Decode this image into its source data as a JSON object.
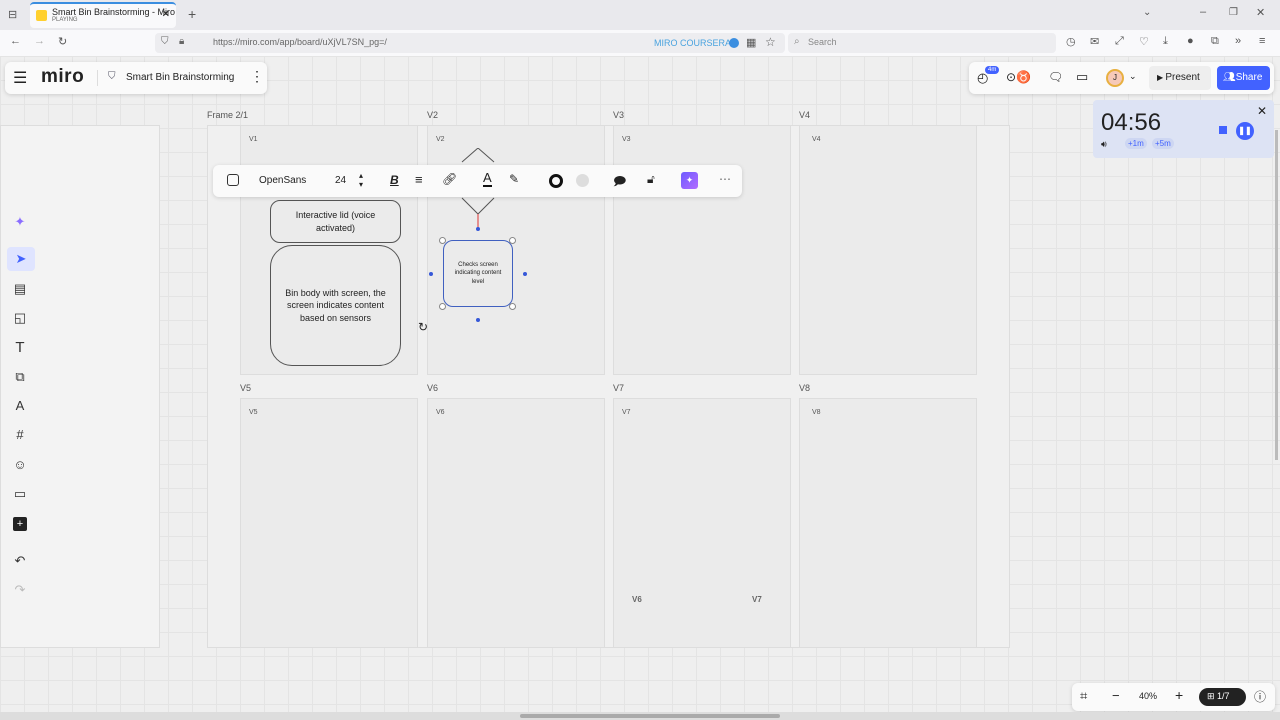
{
  "browser": {
    "tab_title": "Smart Bin Brainstorming - Miro",
    "tab_status": "PLAYING",
    "url_host": "https://miro.com",
    "url_path": "/app/board/uXjVL7SN_pg=/",
    "profile_label": "MIRO COURSERA",
    "search_placeholder": "Search"
  },
  "header": {
    "logo": "miro",
    "board_title": "Smart Bin Brainstorming"
  },
  "topright": {
    "timer_badge": "4m",
    "avatar_initial": "J",
    "present_label": "Present",
    "share_label": "Share"
  },
  "timer": {
    "time_min": "04",
    "time_sec": "56",
    "add1": "+1m",
    "add5": "+5m"
  },
  "toolbar": {
    "font": "OpenSans",
    "font_size": "24"
  },
  "frames": {
    "title": "Frame 2/1",
    "labels": [
      "V2",
      "V3",
      "V4",
      "V5",
      "V6",
      "V7",
      "V8"
    ],
    "inner": [
      "V1",
      "V2",
      "V3",
      "V4",
      "V5",
      "V6",
      "V7",
      "V8"
    ]
  },
  "shapes": {
    "lid": "Interactive lid (voice activated)",
    "body": "Bin body with screen, the screen indicates content based on sensors",
    "check": "Checks screen indicating content level"
  },
  "stickers": {
    "a": "V6",
    "b": "V7"
  },
  "bottom": {
    "zoom": "40%",
    "pages": "1/7"
  },
  "colors": {
    "accent": "#4262ff",
    "timer_bg": "#dde3f4"
  }
}
